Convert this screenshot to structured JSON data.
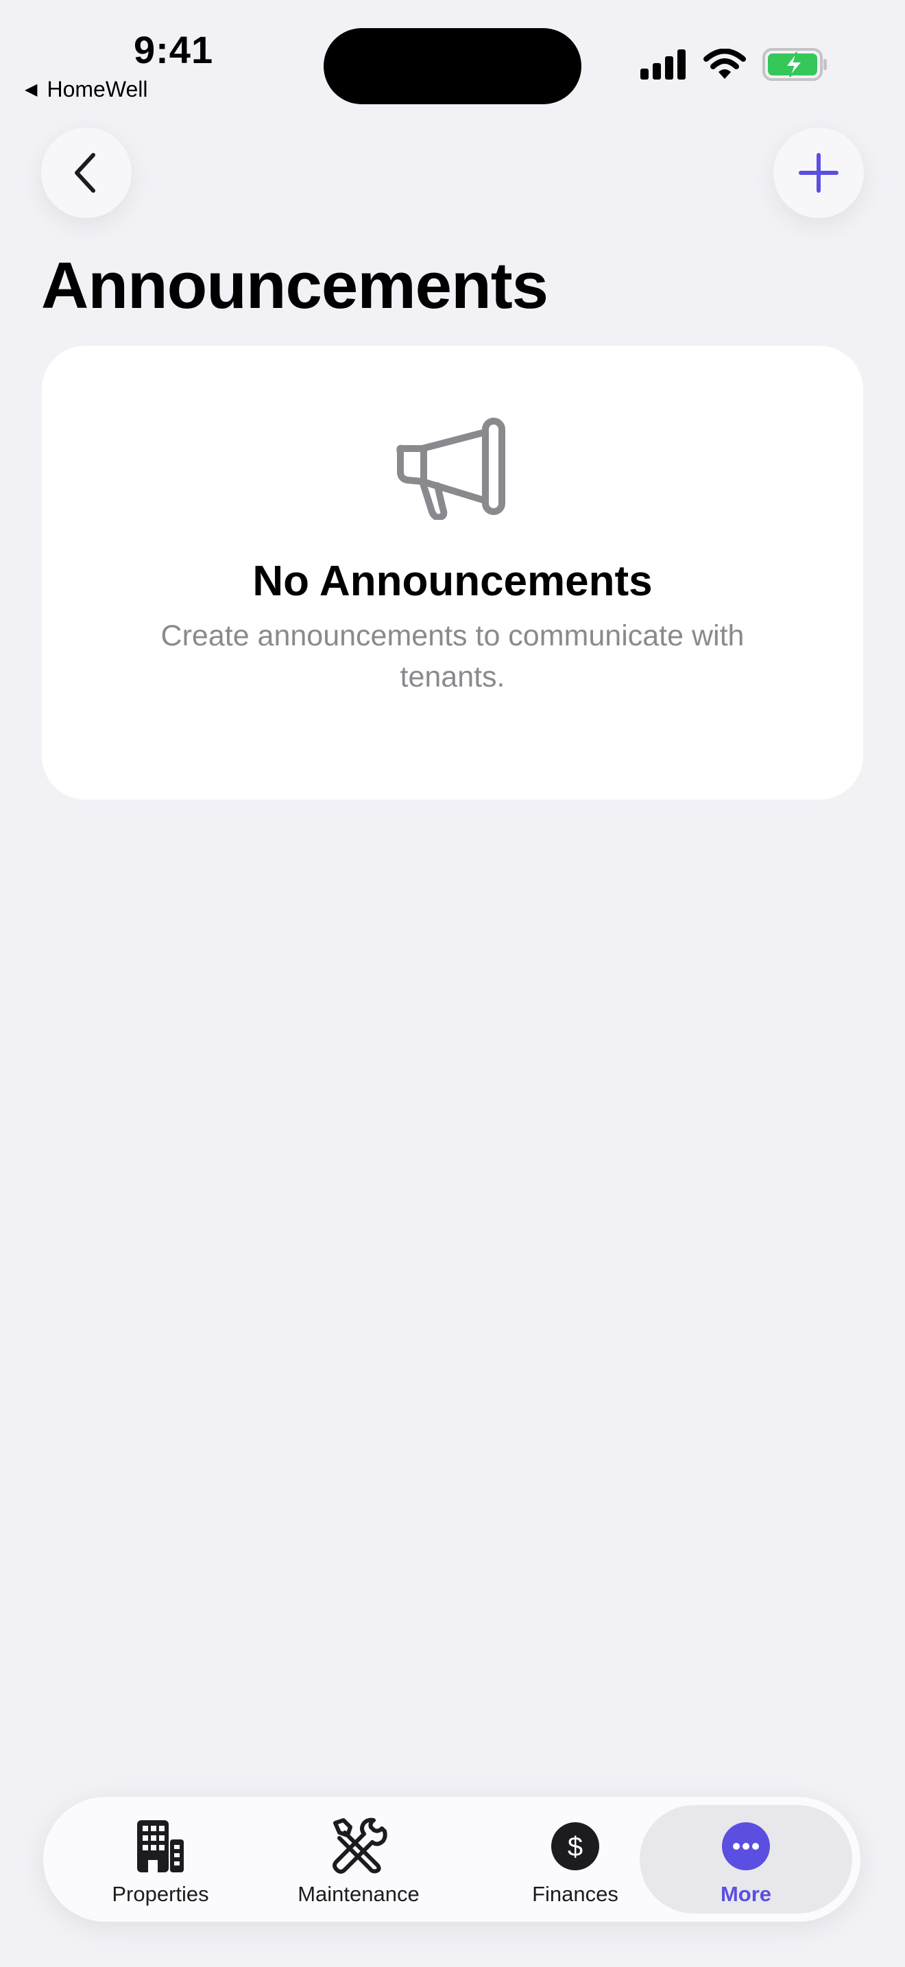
{
  "status_bar": {
    "time": "9:41",
    "back_app": "HomeWell",
    "back_app_icon": "back-triangle-icon",
    "icons": [
      "cellular-signal-icon",
      "wifi-icon",
      "battery-charging-icon"
    ],
    "battery_color": "#34c759"
  },
  "nav": {
    "back_icon": "chevron-left-icon",
    "add_icon": "plus-icon",
    "accent_color": "#5a4fe0"
  },
  "page": {
    "title": "Announcements"
  },
  "empty_state": {
    "icon": "megaphone-icon",
    "title": "No Announcements",
    "description": "Create announcements to communicate with tenants."
  },
  "tab_bar": {
    "selected": "More",
    "items": [
      {
        "label": "Properties",
        "icon": "building-icon"
      },
      {
        "label": "Maintenance",
        "icon": "tools-icon"
      },
      {
        "label": "Finances",
        "icon": "dollar-circle-icon"
      },
      {
        "label": "More",
        "icon": "more-ellipsis-icon"
      }
    ]
  }
}
